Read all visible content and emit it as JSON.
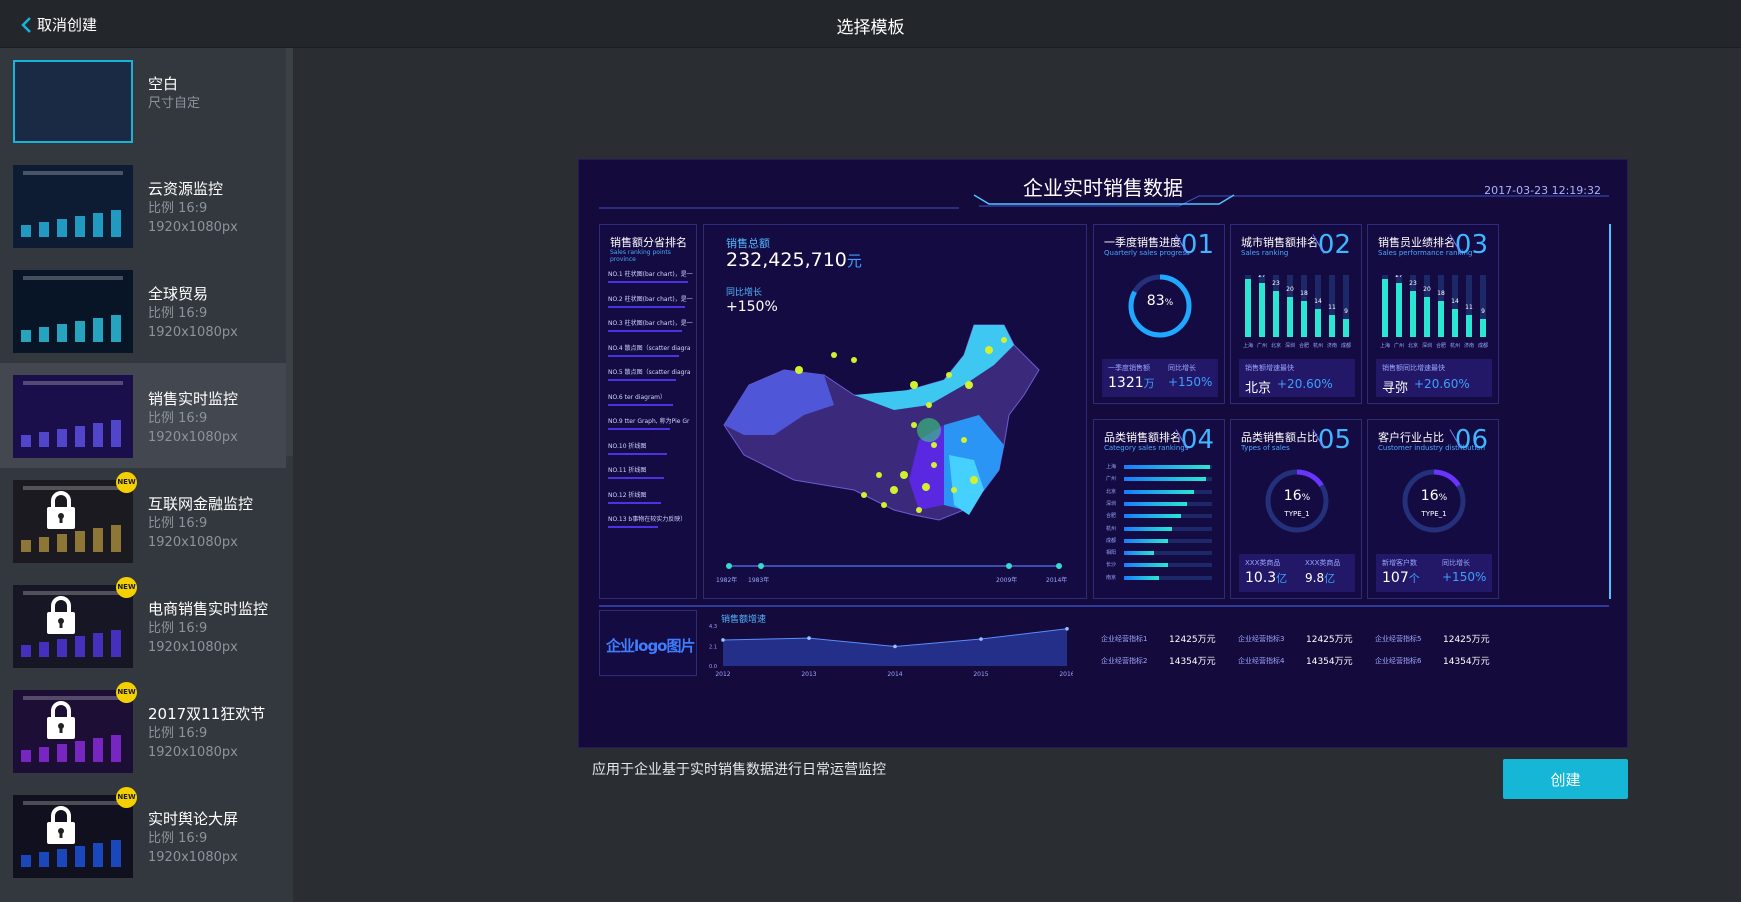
{
  "topbar": {
    "back_label": "取消创建",
    "title": "选择模板"
  },
  "templates": [
    {
      "name": "空白",
      "sub1": "尺寸自定",
      "sub2": "",
      "locked": false
    },
    {
      "name": "云资源监控",
      "sub1": "比例 16:9",
      "sub2": "1920x1080px",
      "locked": false
    },
    {
      "name": "全球贸易",
      "sub1": "比例 16:9",
      "sub2": "1920x1080px",
      "locked": false
    },
    {
      "name": "销售实时监控",
      "sub1": "比例 16:9",
      "sub2": "1920x1080px",
      "locked": false
    },
    {
      "name": "互联网金融监控",
      "sub1": "比例 16:9",
      "sub2": "1920x1080px",
      "locked": true
    },
    {
      "name": "电商销售实时监控",
      "sub1": "比例 16:9",
      "sub2": "1920x1080px",
      "locked": true
    },
    {
      "name": "2017双11狂欢节",
      "sub1": "比例 16:9",
      "sub2": "1920x1080px",
      "locked": true
    },
    {
      "name": "实时舆论大屏",
      "sub1": "比例 16:9",
      "sub2": "1920x1080px",
      "locked": true
    }
  ],
  "badge": "NEW",
  "preview": {
    "title": "企业实时销售数据",
    "time": "2017-03-23 12:19:32",
    "rank_title": "销售额分省排名",
    "rank_sub": "Sales ranking points province",
    "rank_items": [
      "NO.1  柱状图(bar chart)，是一",
      "NO.2  柱状图(bar chart)，是一",
      "NO.3  柱状图(bar chart)，是一",
      "NO.4  散点图（scatter diagra",
      "NO.5  散点图（scatter diagra",
      "NO.6  ter diagram）",
      "NO.9  tter Graph, 称为Pie Gr",
      "NO.10  折线图",
      "NO.11  折线图",
      "NO.12  折线图",
      "NO.13  b事物在较实力反映）"
    ],
    "sales_label": "销售总额",
    "sales_value": "232,425,710",
    "sales_unit": "元",
    "yoy_label": "同比增长",
    "yoy_value": "+150%",
    "timeline": [
      "1982年",
      "1983年",
      "2009年",
      "2014年"
    ],
    "p1": {
      "title": "一季度销售进度",
      "sub": "Quarterly sales progress",
      "no": "01",
      "pct": "83",
      "pct_unit": "%",
      "l1": "一季度销售额",
      "v1": "1321",
      "u1": "万",
      "l2": "同比增长",
      "v2": "+150%"
    },
    "p2": {
      "title": "城市销售额排名",
      "sub": "Sales ranking",
      "no": "02",
      "l": "销售额增速最快",
      "city": "北京",
      "v": "+20.60%"
    },
    "p3": {
      "title": "销售员业绩排名",
      "sub": "Sales performance ranking",
      "no": "03",
      "l": "销售额同比增速最快",
      "city": "寻弥",
      "v": "+20.60%"
    },
    "p4": {
      "title": "品类销售额排名",
      "sub": "Category sales rankings",
      "no": "04"
    },
    "p5": {
      "title": "品类销售额占比",
      "sub": "Types of sales",
      "no": "05",
      "pct": "16",
      "pct_unit": "%",
      "type": "TYPE_1",
      "l1": "XXX类商品",
      "v1": "10.3",
      "u1": "亿",
      "l2": "XXX类商品",
      "v2": "9.8",
      "u2": "亿"
    },
    "p6": {
      "title": "客户行业占比",
      "sub": "Customer industry distribution",
      "no": "06",
      "pct": "16",
      "pct_unit": "%",
      "type": "TYPE_1",
      "l1": "新增客户数",
      "v1": "107",
      "u1": "个",
      "l2": "同比增长",
      "v2": "+150%"
    },
    "logo": "企业logo图片",
    "growth_title": "销售额增速",
    "metrics": [
      {
        "l": "企业经营指标1",
        "v": "12425万元"
      },
      {
        "l": "企业经营指标2",
        "v": "14354万元"
      },
      {
        "l": "企业经营指标3",
        "v": "12425万元"
      },
      {
        "l": "企业经营指标4",
        "v": "14354万元"
      },
      {
        "l": "企业经营指标5",
        "v": "12425万元"
      },
      {
        "l": "企业经营指标6",
        "v": "14354万元"
      }
    ]
  },
  "description": "应用于企业基于实时销售数据进行日常运营监控",
  "create_label": "创建",
  "chart_data": [
    {
      "type": "bar",
      "title": "城市销售额排名",
      "categories": [
        "上海",
        "广州",
        "北京",
        "深圳",
        "合肥",
        "杭州",
        "济南",
        "成都"
      ],
      "values": [
        29,
        27,
        23,
        20,
        18,
        14,
        11,
        9
      ]
    },
    {
      "type": "bar",
      "title": "销售员业绩排名",
      "categories": [
        "上海",
        "广州",
        "北京",
        "深圳",
        "合肥",
        "杭州",
        "济南",
        "成都"
      ],
      "values": [
        29,
        27,
        23,
        20,
        18,
        14,
        11,
        9
      ]
    },
    {
      "type": "bar",
      "title": "品类销售额排名",
      "categories": [
        "上海",
        "广州",
        "北京",
        "深圳",
        "合肥",
        "杭州",
        "成都",
        "相阳",
        "长沙",
        "南京"
      ],
      "values": [
        0.98,
        0.93,
        0.8,
        0.72,
        0.65,
        0.55,
        0.5,
        0.34,
        0.5,
        0.4
      ]
    },
    {
      "type": "area",
      "title": "销售额增速",
      "x": [
        "2012",
        "2013",
        "2014",
        "2015",
        "2016"
      ],
      "y": [
        2.8,
        3.0,
        2.1,
        2.9,
        4.0
      ],
      "ylim": [
        0,
        4.3
      ],
      "yticks": [
        "0.0",
        "2.1",
        "4.3"
      ]
    }
  ]
}
